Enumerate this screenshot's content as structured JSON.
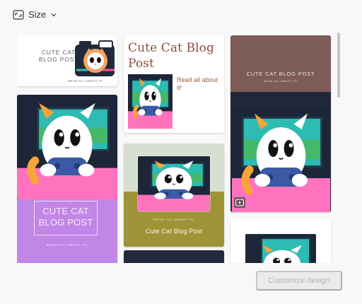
{
  "size_filter": {
    "label": "Size",
    "icon": "size-icon",
    "chevron": "chevron-down-icon"
  },
  "templates": [
    {
      "name": "cat-blog-camera-card",
      "title": "CUTE CAT\nBLOG POST",
      "subtitle": "READ ALL ABOUT IT!"
    },
    {
      "name": "cat-blog-serif-card",
      "title": "Cute Cat Blog Post",
      "subtitle": "Read all about it!"
    },
    {
      "name": "cat-blog-maroon-card",
      "title": "CUTE CAT BLOG POST",
      "subtitle": "READ ALL ABOUT IT!",
      "video_icon": "play-icon"
    },
    {
      "name": "cat-blog-purple-card",
      "title": "CUTE CAT\nBLOG POST",
      "subtitle": "READ ALL ABOUT IT!"
    },
    {
      "name": "cat-blog-olive-card",
      "title": "Cute Cat Blog Post",
      "subtitle": "READ ALL ABOUT IT!"
    },
    {
      "name": "cat-blog-bottom-dark-card"
    },
    {
      "name": "cat-blog-bottom-light-card"
    }
  ],
  "footer": {
    "customize_label": "Customize design"
  },
  "colors": {
    "panel": "#f8f8f8",
    "maroon": "#7d5b58",
    "purple": "#c286e6",
    "olive": "#9e9337",
    "navy": "#22293c"
  }
}
